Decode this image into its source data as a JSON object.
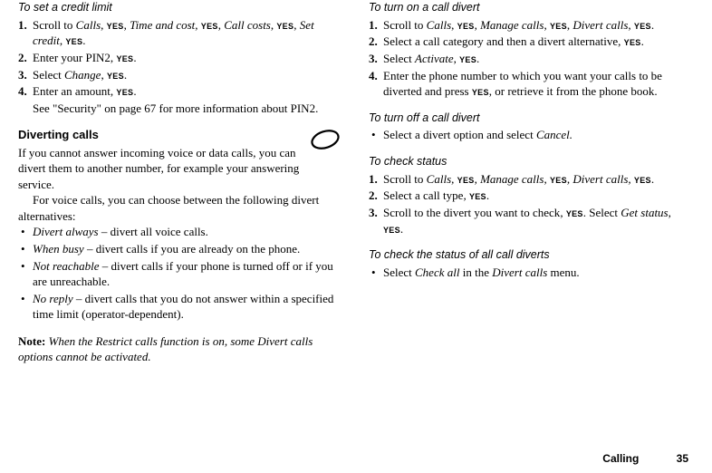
{
  "left": {
    "h1": "To set a credit limit",
    "s1_pre": "Scroll to ",
    "s1_calls": "Calls",
    "s1_comma": ", ",
    "s1_time": "Time and cost",
    "s1_callcosts": "Call costs",
    "s1_setcredit": "Set credit",
    "s1_dot": ".",
    "s2_pre": "Enter your PIN2, ",
    "s3_pre": "Select ",
    "s3_change": "Change",
    "s4_pre": "Enter an amount, ",
    "s4_note": "See \"Security\" on page 67 for more information about PIN2.",
    "divert_head": "Diverting calls",
    "divert_p1": "If you cannot answer incoming voice or data calls, you can divert them to another number, for example your answering service.",
    "divert_p2": "For voice calls, you can choose between the following divert alternatives:",
    "b1_name": "Divert always",
    "b1_rest": " – divert all voice calls.",
    "b2_name": "When busy",
    "b2_rest": " – divert calls if you are already on the phone.",
    "b3_name": "Not reachable",
    "b3_rest": " – divert calls if your phone is turned off or if you are unreachable.",
    "b4_name": "No reply",
    "b4_rest": " – divert calls that you do not answer within a specified time limit (operator-dependent).",
    "note_bold": "Note: ",
    "note_text": "When the Restrict calls function is on, some Divert calls options cannot be activated."
  },
  "right": {
    "h1": "To turn on a call divert",
    "r1a_pre": "Scroll to ",
    "r1a_calls": "Calls",
    "r1a_manage": "Manage calls",
    "r1a_divert": "Divert calls",
    "r2a": "Select a call category and then a divert alternative, ",
    "r3a_pre": "Select ",
    "r3a_activate": "Activate",
    "r4a_pre": "Enter the phone number to which you want your calls to be diverted and press ",
    "r4a_post": ", or retrieve it from the phone book.",
    "h2": "To turn off a call divert",
    "off_bullet_pre": "Select a divert option and select ",
    "off_bullet_cancel": "Cancel.",
    "h3": "To check status",
    "c1_pre": "Scroll to ",
    "c1_calls": "Calls, ",
    "c1_manage": ", Manage calls, ",
    "c1_divert": ", Divert calls, ",
    "c2_pre": "Select a call type",
    "c3_pre": "Scroll to the divert you want to check",
    "c3_select": ". Select ",
    "c3_get": "Get status",
    "h4": "To check the status of all call diverts",
    "all_pre": "Select ",
    "all_checkall": "Check all",
    "all_mid": " in the ",
    "all_divcalls": "Divert calls",
    "all_end": " menu."
  },
  "yes": "YES",
  "footer": {
    "section": "Calling",
    "page": "35"
  }
}
